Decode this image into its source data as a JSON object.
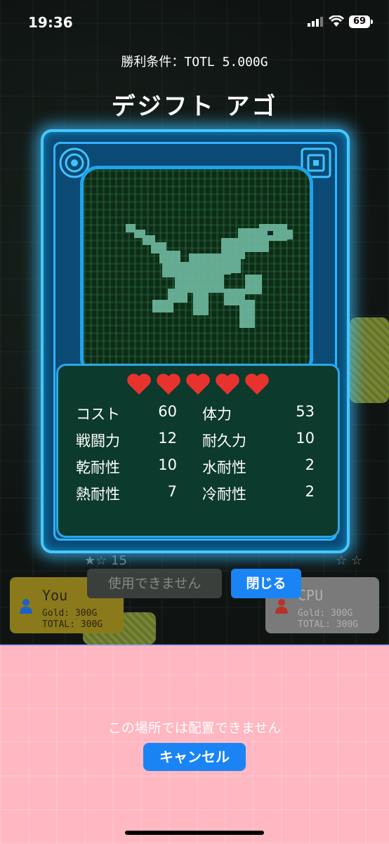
{
  "status_bar": {
    "time": "19:36",
    "battery": "69"
  },
  "header": {
    "win_condition": "勝利条件：TOTL 5.000G",
    "card_name": "デジフト アゴ"
  },
  "card": {
    "hearts": 5,
    "stats": [
      {
        "label": "コスト",
        "value": "60",
        "label2": "体力",
        "value2": "53"
      },
      {
        "label": "戦闘力",
        "value": "12",
        "label2": "耐久力",
        "value2": "10"
      },
      {
        "label": "乾耐性",
        "value": "10",
        "label2": "水耐性",
        "value2": "2"
      },
      {
        "label": "熱耐性",
        "value": "7",
        "label2": "冷耐性",
        "value2": "2"
      }
    ]
  },
  "actions": {
    "use_label": "使用できません",
    "close_label": "閉じる"
  },
  "players": {
    "you": {
      "name": "You",
      "gold": "Gold: 300G",
      "total": "TOTAL: 300G"
    },
    "cpu": {
      "name": "CPU",
      "gold": "Gold: 300G",
      "total": "TOTAL: 300G"
    }
  },
  "background": {
    "level_text": "15"
  },
  "panel": {
    "message": "この場所では配置できません",
    "cancel_label": "キャンセル"
  },
  "colors": {
    "accent": "#1a84f5",
    "card_glow": "#49c6ff",
    "panel": "#ffb7c2",
    "heart": "#e8322e"
  }
}
